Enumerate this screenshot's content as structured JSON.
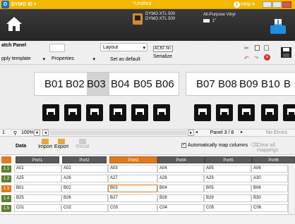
{
  "titlebar": {
    "app_name": "DYMO ID ▾",
    "document_title": "*Untitled",
    "help_label": "Help ▾"
  },
  "printer": {
    "model_line1": "DYMO XTL 500",
    "model_line2": "DYMO XTL 500"
  },
  "label": {
    "type": "All-Purpose Vinyl",
    "size": "1\""
  },
  "panel": {
    "title": "atch Panel",
    "apply_template": "pply template",
    "properties": "Properties",
    "layout": "Layout",
    "set_default": "Set as default",
    "serialize_label": "Serialize",
    "serialize_preview": "A1,B2..Nn"
  },
  "strip1": [
    "B01",
    "B02",
    "B03",
    "B04",
    "B05",
    "B06"
  ],
  "strip2": [
    "B07",
    "B08",
    "B09",
    "B10",
    "B"
  ],
  "status": {
    "zoom": "100%",
    "panel": "Panel 3 / 8",
    "errors": "No Errors",
    "page_mark": "1"
  },
  "datatoolbar": {
    "data": "Data",
    "import": "Import",
    "export": "Export",
    "recall": "Recall",
    "auto_map": "Automatically map columns",
    "clear": "Clear all mappings"
  },
  "table": {
    "columns": [
      "Port1",
      "Port2",
      "Port3",
      "Port4",
      "Port5",
      "Port6"
    ],
    "row_numbers": [
      "1.1",
      "1.2",
      "1.3",
      "1.4",
      "1.5"
    ],
    "rows": [
      [
        "A01",
        "A02",
        "A03",
        "A04",
        "A05",
        "A06"
      ],
      [
        "A25",
        "A26",
        "A27",
        "A28",
        "A29",
        "A30"
      ],
      [
        "B01",
        "B02",
        "B03",
        "B04",
        "B05",
        "B06"
      ],
      [
        "B25",
        "B26",
        "B27",
        "B28",
        "B29",
        "B30"
      ],
      [
        "C01",
        "C02",
        "C03",
        "C04",
        "C05",
        "C06"
      ]
    ]
  },
  "colors": {
    "accent": "#f3b800",
    "selected": "#e07a1f",
    "ribbon": "#2e2e2e"
  }
}
